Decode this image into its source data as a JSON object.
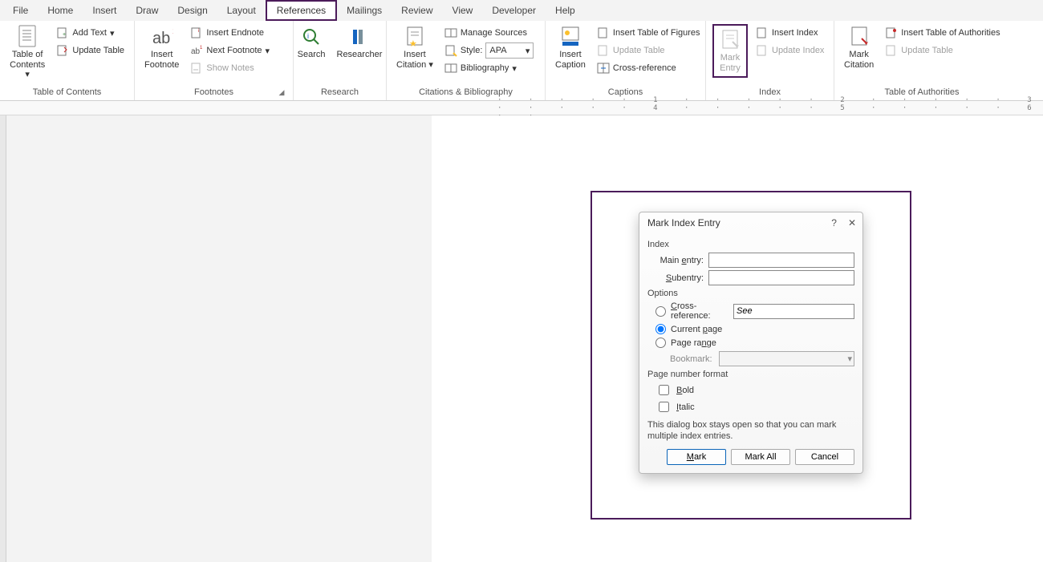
{
  "menu": {
    "tabs": [
      "File",
      "Home",
      "Insert",
      "Draw",
      "Design",
      "Layout",
      "References",
      "Mailings",
      "Review",
      "View",
      "Developer",
      "Help"
    ],
    "active": "References"
  },
  "ribbon": {
    "toc": {
      "label": "Table of Contents",
      "tocBtn": "Table of\nContents",
      "addText": "Add Text",
      "updateTable": "Update Table"
    },
    "footnotes": {
      "label": "Footnotes",
      "insertFootnote": "Insert\nFootnote",
      "insertEndnote": "Insert Endnote",
      "nextFootnote": "Next Footnote",
      "showNotes": "Show Notes"
    },
    "research": {
      "label": "Research",
      "search": "Search",
      "researcher": "Researcher"
    },
    "citations": {
      "label": "Citations & Bibliography",
      "insertCitation": "Insert\nCitation",
      "manageSources": "Manage Sources",
      "styleLabel": "Style:",
      "styleValue": "APA",
      "bibliography": "Bibliography"
    },
    "captions": {
      "label": "Captions",
      "insertCaption": "Insert\nCaption",
      "insertTOF": "Insert Table of Figures",
      "updateTable": "Update Table",
      "crossRef": "Cross-reference"
    },
    "index": {
      "label": "Index",
      "markEntry": "Mark\nEntry",
      "insertIndex": "Insert Index",
      "updateIndex": "Update Index"
    },
    "authorities": {
      "label": "Table of Authorities",
      "markCitation": "Mark\nCitation",
      "insertTOA": "Insert Table of Authorities",
      "updateTable": "Update Table"
    }
  },
  "ruler": "· · · · · 1 · · · · · 2 · · · · · 3 · · · · · 4 · · · · · 5 · · · · · 6 · ·",
  "dialog": {
    "title": "Mark Index Entry",
    "sections": {
      "index": "Index",
      "options": "Options",
      "pnf": "Page number format"
    },
    "mainEntryLabel": "Main entry:",
    "mainEntryValue": "",
    "subentryLabel": "Subentry:",
    "subentryValue": "",
    "crossRefLabel": "Cross-reference:",
    "crossRefValue": "See",
    "currentPageLabel": "Current page",
    "pageRangeLabel": "Page range",
    "bookmarkLabel": "Bookmark:",
    "boldLabel": "Bold",
    "italicLabel": "Italic",
    "hint": "This dialog box stays open so that you can mark multiple index entries.",
    "buttons": {
      "mark": "Mark",
      "markAll": "Mark All",
      "cancel": "Cancel"
    }
  }
}
